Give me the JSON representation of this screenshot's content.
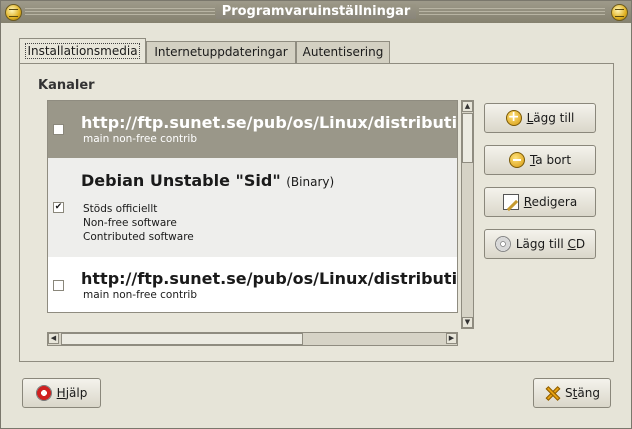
{
  "window": {
    "title": "Programvaruinställningar"
  },
  "tabs": [
    {
      "label": "Installationsmedia",
      "active": true
    },
    {
      "label": "Internetuppdateringar",
      "active": false
    },
    {
      "label": "Autentisering",
      "active": false
    }
  ],
  "section_label": "Kanaler",
  "channels": [
    {
      "name": "http://ftp.sunet.se/pub/os/Linux/distributions/debian",
      "type": "",
      "details": [
        "main non-free contrib"
      ],
      "checked": false,
      "selected": true
    },
    {
      "name": "Debian Unstable \"Sid\"",
      "type": "(Binary)",
      "details": [
        "Stöds officiellt",
        "Non-free software",
        "Contributed software"
      ],
      "checked": true,
      "selected": false
    },
    {
      "name": "http://ftp.sunet.se/pub/os/Linux/distributions/debian",
      "type": "",
      "details": [
        "main non-free contrib"
      ],
      "checked": false,
      "selected": false
    }
  ],
  "buttons": {
    "add": {
      "pre": "",
      "mnemonic": "L",
      "post": "ägg till",
      "icon": "add-icon"
    },
    "remove": {
      "pre": "",
      "mnemonic": "T",
      "post": "a bort",
      "icon": "remove-icon"
    },
    "edit": {
      "pre": "",
      "mnemonic": "R",
      "post": "edigera",
      "icon": "edit-icon"
    },
    "add_cd": {
      "pre": "Lägg till ",
      "mnemonic": "C",
      "post": "D",
      "icon": "cd-icon"
    },
    "help": {
      "pre": "",
      "mnemonic": "H",
      "post": "jälp",
      "icon": "help-icon"
    },
    "close": {
      "pre": "S",
      "mnemonic": "t",
      "post": "äng",
      "icon": "close-icon"
    }
  },
  "colors": {
    "selected_row": "#9a9789",
    "alt_row": "#eeeeec",
    "window_bg": "#e6e4d8"
  }
}
